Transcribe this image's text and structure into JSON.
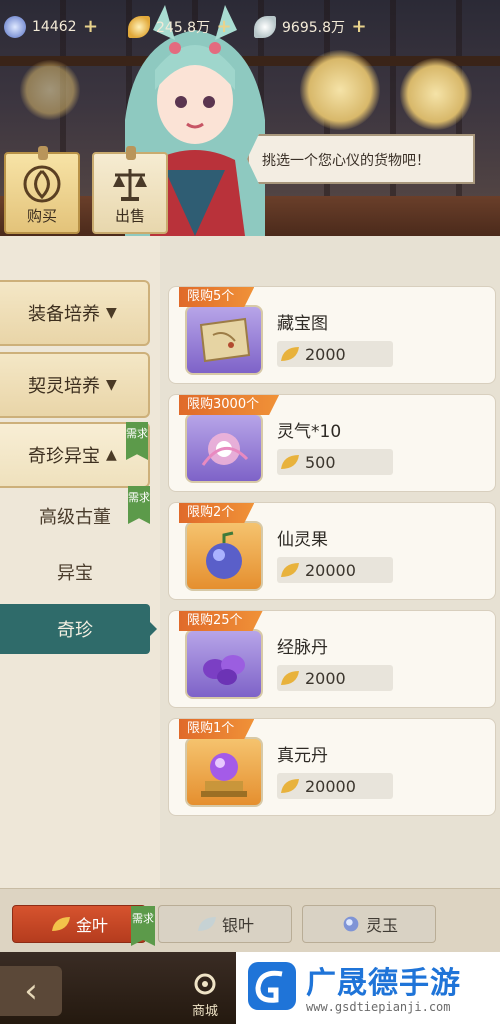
{
  "resources": [
    {
      "icon": "jade-orb-icon",
      "value": "14462"
    },
    {
      "icon": "gold-leaf-icon",
      "value": "245.8万"
    },
    {
      "icon": "silver-leaf-icon",
      "value": "9695.8万"
    }
  ],
  "modes": [
    {
      "label": "购买",
      "icon": "swirl-icon",
      "active": true
    },
    {
      "label": "出售",
      "icon": "scale-icon",
      "active": false
    }
  ],
  "npc": {
    "speech": "挑选一个您心仪的货物吧！"
  },
  "categories": [
    {
      "label": "装备培养",
      "open": false
    },
    {
      "label": "契灵培养",
      "open": false
    },
    {
      "label": "奇珍异宝",
      "open": true,
      "need": "需求"
    }
  ],
  "subcategories": [
    {
      "label": "高级古董",
      "need": "需求",
      "active": false
    },
    {
      "label": "异宝",
      "active": false
    },
    {
      "label": "奇珍",
      "active": true
    }
  ],
  "items": [
    {
      "limit": "限购5个",
      "name": "藏宝图",
      "price": "2000",
      "icon": "treasure-map-icon",
      "bg": "purple"
    },
    {
      "limit": "限购3000个",
      "name": "灵气*10",
      "price": "500",
      "icon": "spirit-energy-icon",
      "bg": "purple"
    },
    {
      "limit": "限购2个",
      "name": "仙灵果",
      "price": "20000",
      "icon": "spirit-fruit-icon",
      "bg": "orange"
    },
    {
      "limit": "限购25个",
      "name": "经脉丹",
      "price": "2000",
      "icon": "meridian-pill-icon",
      "bg": "purple"
    },
    {
      "limit": "限购1个",
      "name": "真元丹",
      "price": "20000",
      "icon": "true-essence-pill-icon",
      "bg": "orange"
    }
  ],
  "currency_tabs": [
    {
      "label": "金叶",
      "icon": "gold-leaf-icon",
      "active": true,
      "need": "需求"
    },
    {
      "label": "银叶",
      "icon": "silver-leaf-icon",
      "active": false
    },
    {
      "label": "灵玉",
      "icon": "jade-orb-icon",
      "active": false
    }
  ],
  "nav": {
    "back_icon": "back-arrow-icon",
    "shop_label": "商城"
  },
  "watermark": {
    "title": "广晟德手游",
    "url": "www.gsdtiepianji.com"
  },
  "colors": {
    "accent_teal": "#2f6b6a",
    "limit_orange": "#e8792e",
    "need_green": "#5c9a4a",
    "active_tab_red": "#c4452a"
  }
}
